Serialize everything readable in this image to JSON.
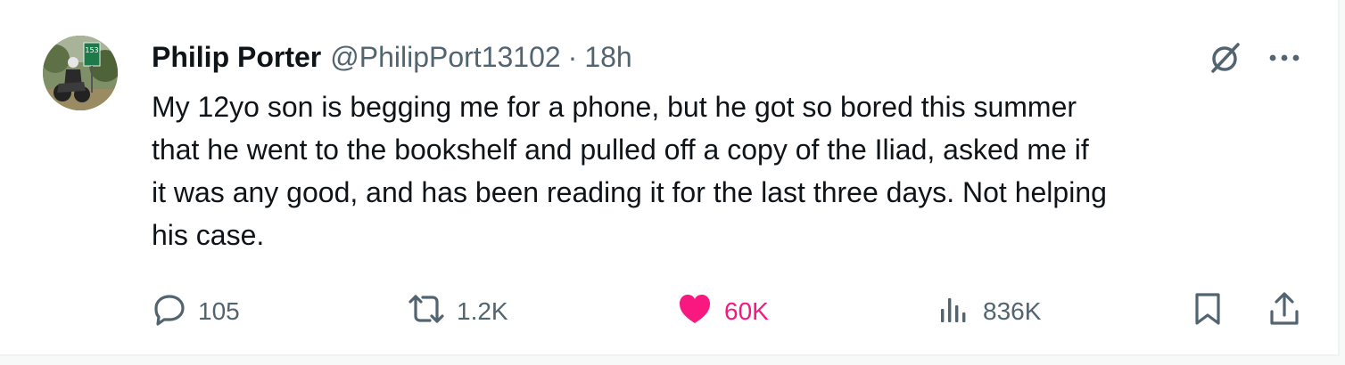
{
  "post": {
    "author_name": "Philip Porter",
    "author_handle": "@PhilipPort13102",
    "separator": "·",
    "timestamp": "18h",
    "text": "My 12yo son is begging me for a phone, but he got so bored this summer\nthat he went to the bookshelf and pulled off a copy of the Iliad, asked me if\nit was any good, and has been reading it for the last three days. Not helping\nhis case.",
    "avatar_sign_text": "153"
  },
  "actions": {
    "replies": "105",
    "reposts": "1.2K",
    "likes": "60K",
    "views": "836K"
  },
  "icons": {
    "grok": "grok-icon",
    "more": "more-icon",
    "reply": "reply-icon",
    "repost": "repost-icon",
    "like": "heart-icon",
    "views": "views-chart-icon",
    "bookmark": "bookmark-icon",
    "share": "share-icon"
  },
  "colors": {
    "text": "#0f1419",
    "secondary": "#536471",
    "like_active": "#f91880"
  }
}
